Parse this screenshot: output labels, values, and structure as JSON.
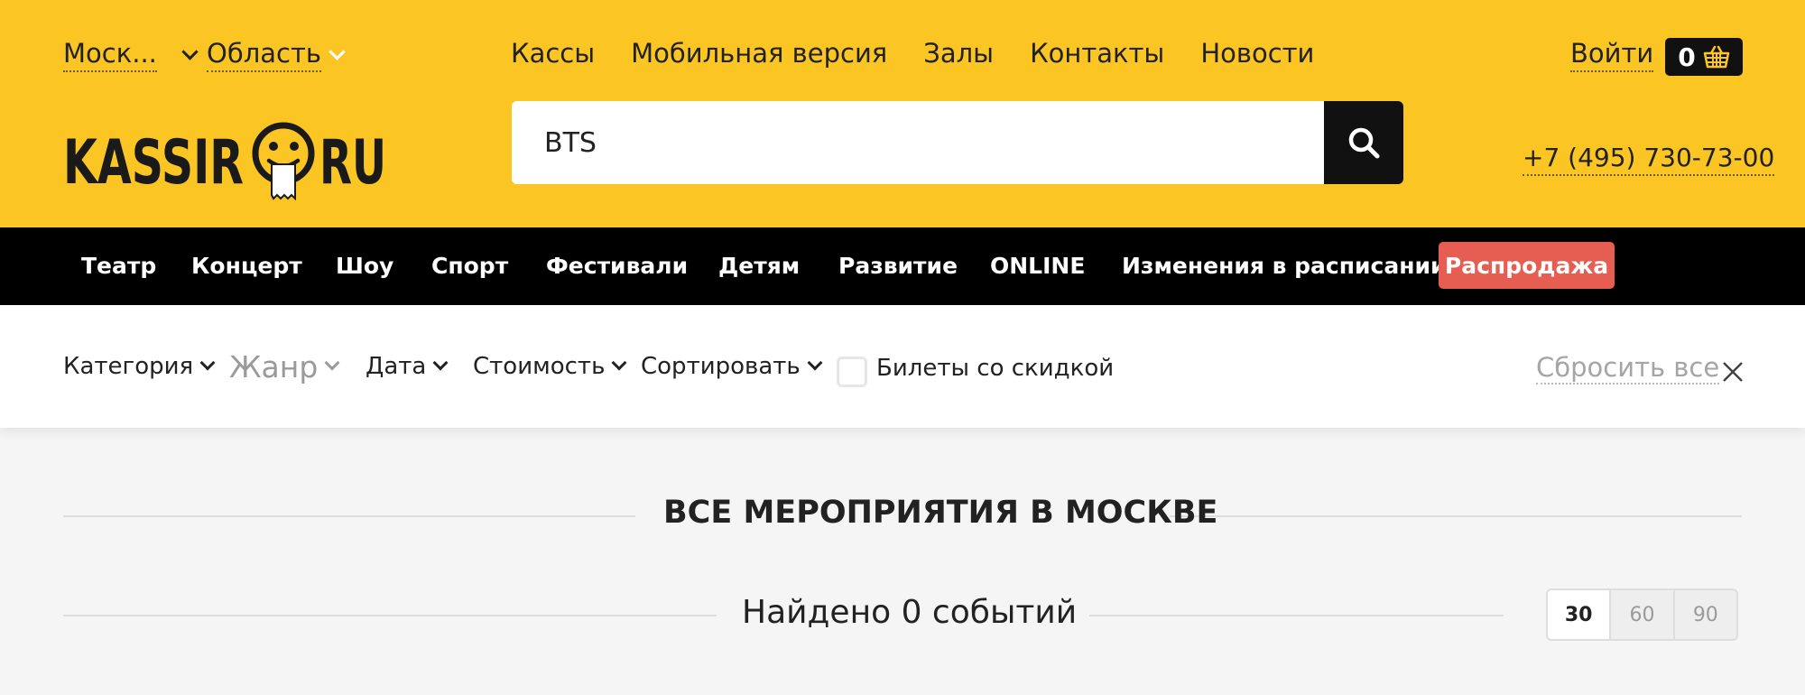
{
  "header": {
    "city": "Моск...",
    "region": "Область",
    "nav": [
      "Кассы",
      "Мобильная версия",
      "Залы",
      "Контакты",
      "Новости"
    ],
    "login_label": "Войти",
    "cart_count": "0",
    "logo": {
      "left_text": "KASSIR",
      "right_text": "RU"
    },
    "search": {
      "value": "BTS"
    },
    "phone": "+7 (495) 730-73-00"
  },
  "categories": {
    "items": [
      "Театр",
      "Концерт",
      "Шоу",
      "Спорт",
      "Фестивали",
      "Детям",
      "Развитие",
      "ONLINE",
      "Изменения в расписании"
    ],
    "sale_label": "Распродажа"
  },
  "filters": {
    "category": "Категория",
    "genre": "Жанр",
    "date": "Дата",
    "price": "Стоимость",
    "sort": "Сортировать",
    "discount_label": "Билеты со скидкой",
    "reset_label": "Сбросить все"
  },
  "content": {
    "section_title": "ВСЕ МЕРОПРИЯТИЯ В МОСКВЕ",
    "found_text": "Найдено 0 событий",
    "per_page": [
      "30",
      "60",
      "90"
    ],
    "per_page_selected": "30"
  },
  "colors": {
    "header_bg": "#fbc524",
    "nav_bg": "#000000",
    "sale_bg": "#e65d51"
  }
}
